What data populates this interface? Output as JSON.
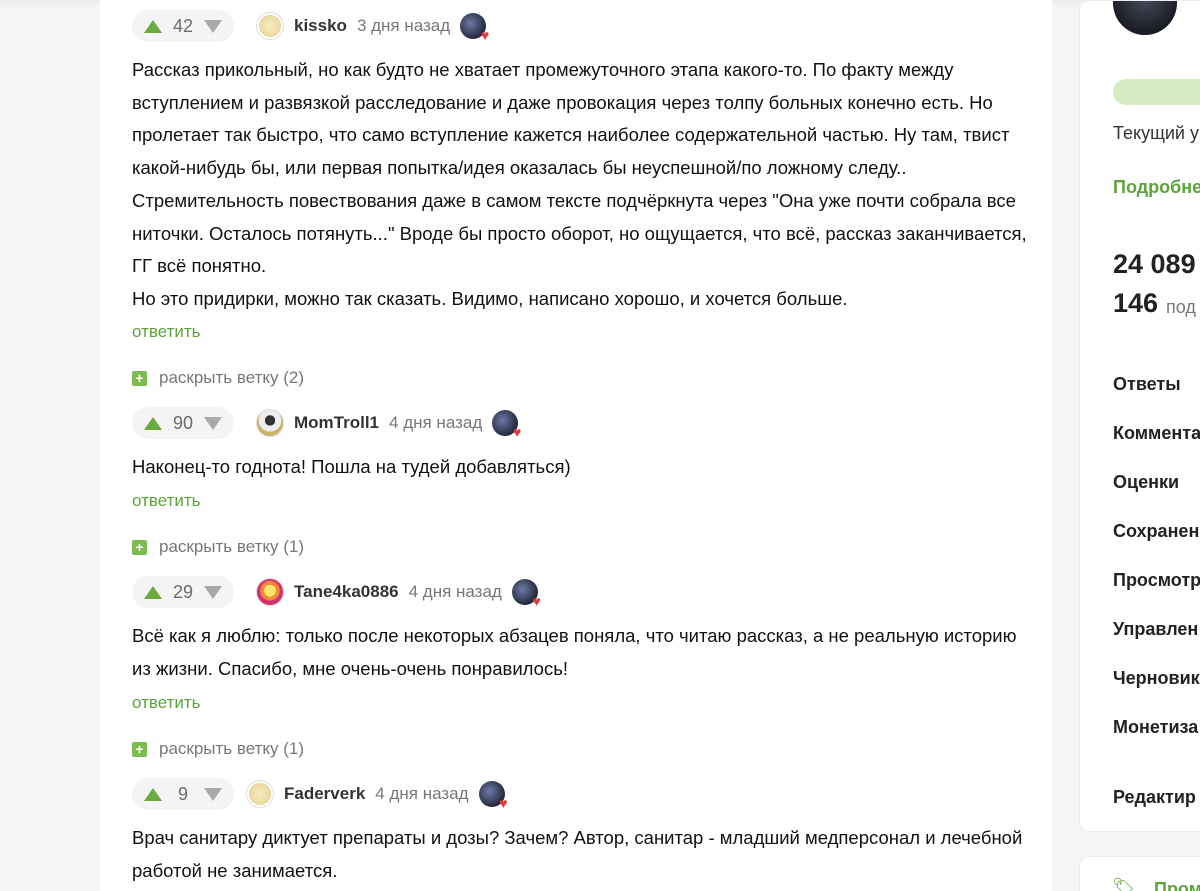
{
  "comments": [
    {
      "votes": "42",
      "author": "kissko",
      "time": "3 дня назад",
      "text": "Рассказ прикольный, но как будто не хватает промежуточного этапа какого-то. По факту между вступлением и развязкой расследование и даже провокация через толпу больных конечно есть. Но пролетает так быстро, что само вступление кажется наиболее содержательной частью. Ну там, твист какой-нибудь бы, или первая попытка/идея оказалась бы неуспешной/по ложному следу.. Стремительность повествования даже в самом тексте подчёркнута через \"Она уже почти собрала все ниточки. Осталось потянуть...\" Вроде бы просто оборот, но ощущается, что всё, рассказ заканчивается, ГГ всё понятно.",
      "text2": "Но это придирки, можно так сказать. Видимо, написано хорошо, и хочется больше.",
      "reply": "ответить",
      "expand": "раскрыть ветку (2)"
    },
    {
      "votes": "90",
      "author": "MomTroll1",
      "time": "4 дня назад",
      "text": "Наконец-то годнота! Пошла на тудей добавляться)",
      "reply": "ответить",
      "expand": "раскрыть ветку (1)"
    },
    {
      "votes": "29",
      "author": "Tane4ka0886",
      "time": "4 дня назад",
      "text": "Всё как я люблю: только после некоторых абзацев поняла, что читаю рассказ, а не реальную историю из жизни. Спасибо, мне очень-очень понравилось!",
      "reply": "ответить",
      "expand": "раскрыть ветку (1)"
    },
    {
      "votes": "9",
      "author": "Faderverk",
      "time": "4 дня назад",
      "text": "Врач санитару диктует препараты и дозы? Зачем? Автор, санитар - младший медперсонал и лечебной работой не занимается."
    }
  ],
  "sidebar": {
    "current_label": "Текущий у",
    "details_link": "Подробне",
    "stat1_value": "24 089",
    "stat2_value": "146",
    "stat2_label": "под",
    "menu": [
      "Ответы",
      "Коммента",
      "Оценки",
      "Сохранен",
      "Просмотр",
      "Управлен",
      "Черновик",
      "Монетиза",
      "Редактир"
    ],
    "bottom_label": "Пром"
  },
  "colors": {
    "accent_green": "#5da33b",
    "upvote_green": "#6ca93f",
    "downvote_grey": "#a9a9a9"
  }
}
